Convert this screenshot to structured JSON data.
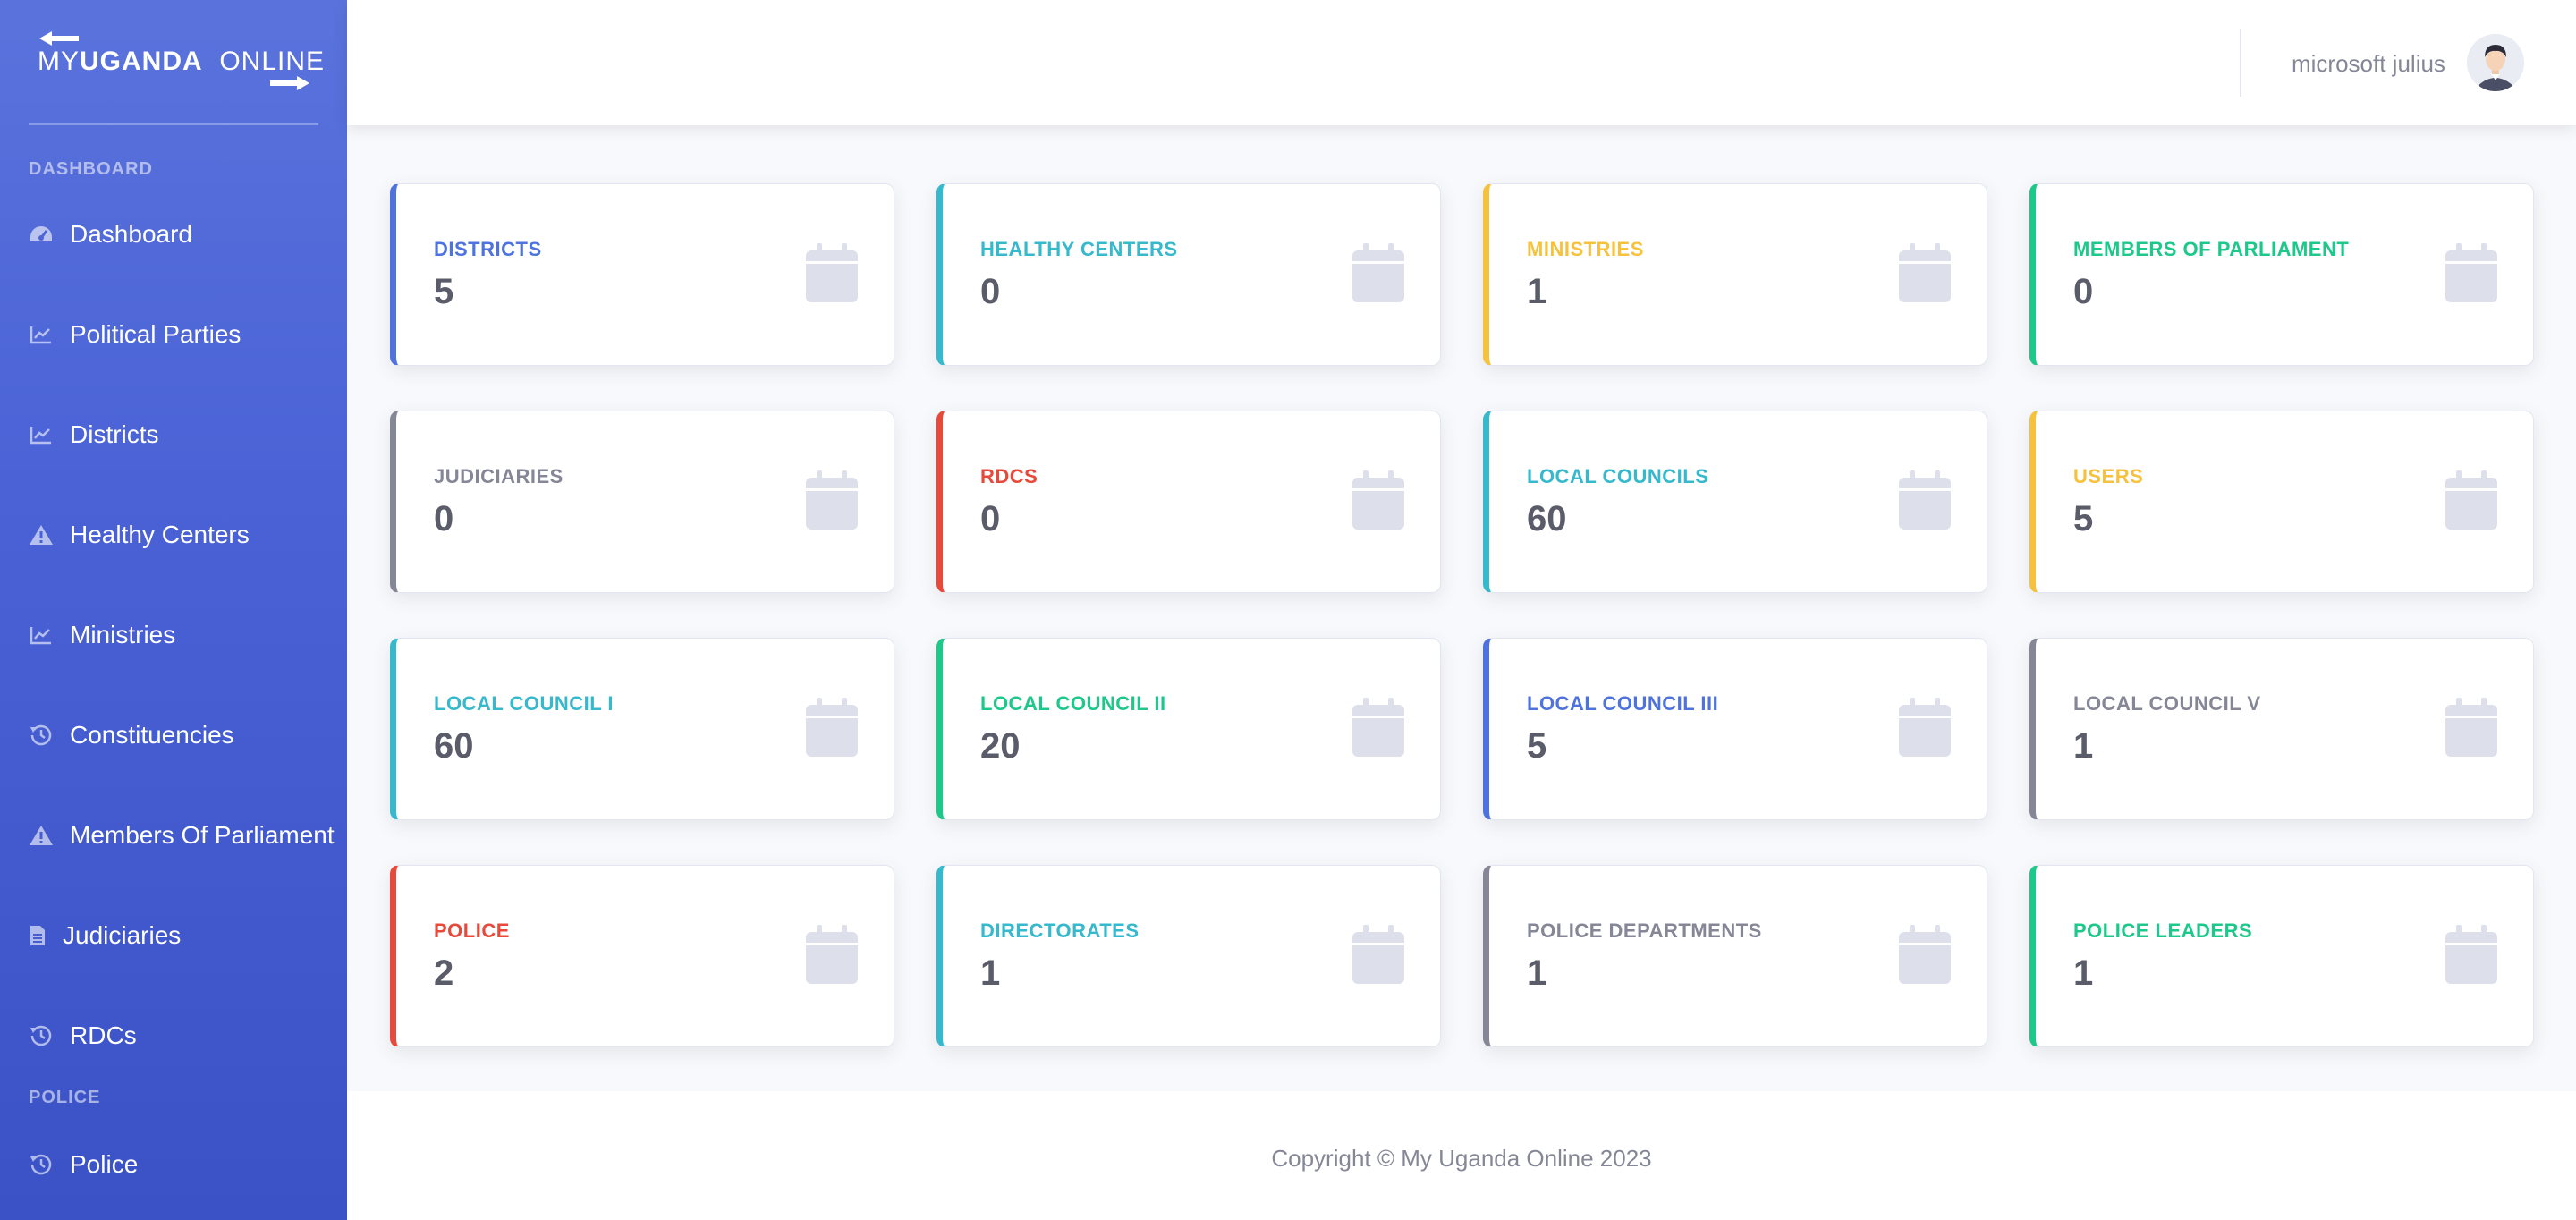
{
  "brand": {
    "prefix": "MY",
    "name": "UGANDA",
    "suffix": "ONLINE"
  },
  "sidebar": {
    "heading_dashboard": "DASHBOARD",
    "heading_police": "POLICE",
    "items": [
      {
        "label": "Dashboard",
        "icon": "gauge-icon"
      },
      {
        "label": "Political Parties",
        "icon": "chart-line-icon"
      },
      {
        "label": "Districts",
        "icon": "chart-line-icon"
      },
      {
        "label": "Healthy Centers",
        "icon": "warning-icon"
      },
      {
        "label": "Ministries",
        "icon": "chart-line-icon"
      },
      {
        "label": "Constituencies",
        "icon": "history-icon"
      },
      {
        "label": "Members Of Parliament",
        "icon": "warning-icon"
      },
      {
        "label": "Judiciaries",
        "icon": "file-icon"
      },
      {
        "label": "RDCs",
        "icon": "history-icon"
      },
      {
        "label": "Police",
        "icon": "history-icon"
      }
    ]
  },
  "topbar": {
    "user_name": "microsoft julius"
  },
  "colors": {
    "primary": "#4e73df",
    "info": "#36b9cc",
    "warning": "#f6c23e",
    "success": "#1cc88a",
    "secondary": "#858796",
    "danger": "#e74a3b",
    "icon": "#dddfeb"
  },
  "cards": [
    {
      "label": "DISTRICTS",
      "value": "5",
      "color": "#4e73df"
    },
    {
      "label": "HEALTHY CENTERS",
      "value": "0",
      "color": "#36b9cc"
    },
    {
      "label": "MINISTRIES",
      "value": "1",
      "color": "#f6c23e"
    },
    {
      "label": "MEMBERS OF PARLIAMENT",
      "value": "0",
      "color": "#1cc88a"
    },
    {
      "label": "JUDICIARIES",
      "value": "0",
      "color": "#858796"
    },
    {
      "label": "RDCS",
      "value": "0",
      "color": "#e74a3b"
    },
    {
      "label": "LOCAL COUNCILS",
      "value": "60",
      "color": "#36b9cc"
    },
    {
      "label": "USERS",
      "value": "5",
      "color": "#f6c23e"
    },
    {
      "label": "LOCAL COUNCIL I",
      "value": "60",
      "color": "#36b9cc"
    },
    {
      "label": "LOCAL COUNCIL II",
      "value": "20",
      "color": "#1cc88a"
    },
    {
      "label": "LOCAL COUNCIL III",
      "value": "5",
      "color": "#4e73df"
    },
    {
      "label": "LOCAL COUNCIL V",
      "value": "1",
      "color": "#858796"
    },
    {
      "label": "POLICE",
      "value": "2",
      "color": "#e74a3b"
    },
    {
      "label": "DIRECTORATES",
      "value": "1",
      "color": "#36b9cc"
    },
    {
      "label": "POLICE DEPARTMENTS",
      "value": "1",
      "color": "#858796"
    },
    {
      "label": "POLICE LEADERS",
      "value": "1",
      "color": "#1cc88a"
    }
  ],
  "card_icon": "calendar-icon",
  "footer": {
    "text": "Copyright © My Uganda Online 2023"
  }
}
